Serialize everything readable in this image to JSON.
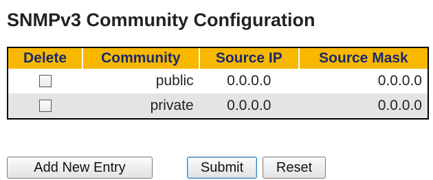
{
  "page": {
    "title": "SNMPv3 Community Configuration"
  },
  "table": {
    "headers": {
      "delete": "Delete",
      "community": "Community",
      "source_ip": "Source IP",
      "source_mask": "Source Mask"
    },
    "rows": [
      {
        "delete_checked": false,
        "community": "public",
        "source_ip": "0.0.0.0",
        "source_mask": "0.0.0.0"
      },
      {
        "delete_checked": false,
        "community": "private",
        "source_ip": "0.0.0.0",
        "source_mask": "0.0.0.0"
      }
    ]
  },
  "buttons": {
    "add_new_entry": "Add New Entry",
    "submit": "Submit",
    "reset": "Reset"
  },
  "colors": {
    "header_background": "#f8b800",
    "header_text": "#1a2a6a",
    "row_alt_background": "#e4e4e4"
  }
}
